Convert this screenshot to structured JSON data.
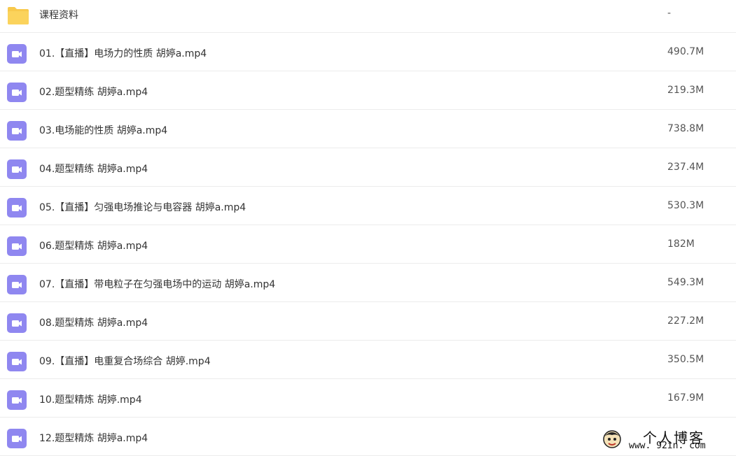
{
  "files": [
    {
      "name": "课程资料",
      "size": "-",
      "icon": "folder-icon",
      "type": "folder"
    },
    {
      "name": "01.【直播】电场力的性质 胡婷a.mp4",
      "size": "490.7M",
      "icon": "video-icon",
      "type": "video"
    },
    {
      "name": "02.题型精练 胡婷a.mp4",
      "size": "219.3M",
      "icon": "video-icon",
      "type": "video"
    },
    {
      "name": "03.电场能的性质 胡婷a.mp4",
      "size": "738.8M",
      "icon": "video-icon",
      "type": "video"
    },
    {
      "name": "04.题型精练 胡婷a.mp4",
      "size": "237.4M",
      "icon": "video-icon",
      "type": "video"
    },
    {
      "name": "05.【直播】匀强电场推论与电容器 胡婷a.mp4",
      "size": "530.3M",
      "icon": "video-icon",
      "type": "video"
    },
    {
      "name": "06.题型精炼 胡婷a.mp4",
      "size": "182M",
      "icon": "video-icon",
      "type": "video"
    },
    {
      "name": "07.【直播】带电粒子在匀强电场中的运动 胡婷a.mp4",
      "size": "549.3M",
      "icon": "video-icon",
      "type": "video"
    },
    {
      "name": "08.题型精炼 胡婷a.mp4",
      "size": "227.2M",
      "icon": "video-icon",
      "type": "video"
    },
    {
      "name": "09.【直播】电重复合场综合 胡婷.mp4",
      "size": "350.5M",
      "icon": "video-icon",
      "type": "video"
    },
    {
      "name": "10.题型精炼 胡婷.mp4",
      "size": "167.9M",
      "icon": "video-icon",
      "type": "video"
    },
    {
      "name": "12.题型精炼 胡婷a.mp4",
      "size": "",
      "icon": "video-icon",
      "type": "video"
    }
  ],
  "watermark": {
    "title": "个人博客",
    "url": "www. 92in. com"
  },
  "colors": {
    "folder": "#f8c94c",
    "video": "#8f87f0",
    "divider": "#ececec"
  }
}
